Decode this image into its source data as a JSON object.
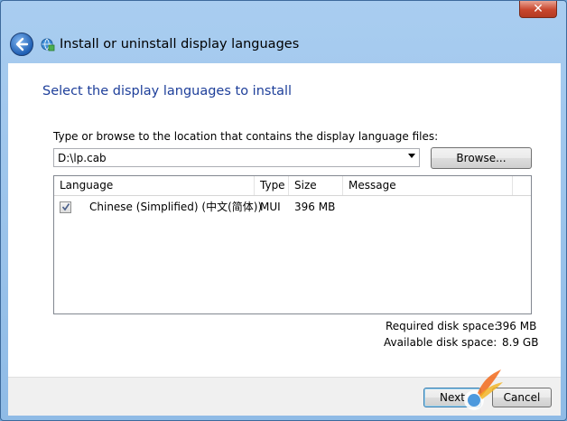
{
  "window": {
    "close_glyph": "✕",
    "title": "Install or uninstall display languages"
  },
  "page": {
    "heading": "Select the display languages to install",
    "path_label": "Type or browse to the location that contains the display language files:",
    "path_value": "D:\\lp.cab",
    "browse_label": "Browse..."
  },
  "table": {
    "columns": [
      "Language",
      "Type",
      "Size",
      "Message"
    ],
    "rows": [
      {
        "checked": true,
        "language": "Chinese (Simplified) (中文(简体))",
        "type": "MUI",
        "size": "396 MB",
        "message": ""
      }
    ]
  },
  "disk": {
    "required_label": "Required disk space:",
    "required_value": "396 MB",
    "available_label": "Available disk space:",
    "available_value": "8.9 GB"
  },
  "footer": {
    "next_label": "Next",
    "cancel_label": "Cancel"
  },
  "colors": {
    "heading": "#1e3f9a",
    "close": "#c8462d"
  }
}
